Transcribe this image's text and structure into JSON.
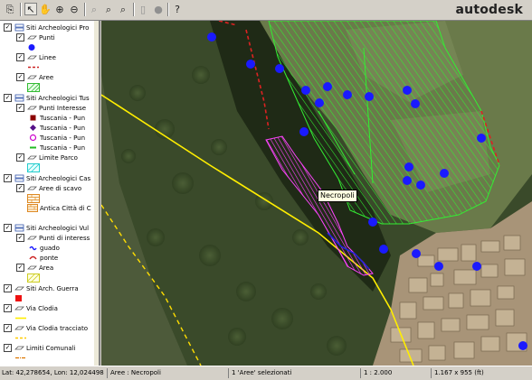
{
  "brand": "autodesk",
  "toolbar": {
    "buttons": [
      {
        "name": "copy-icon",
        "glyph": "⎘"
      },
      {
        "name": "select-arrow-icon",
        "glyph": "↖"
      },
      {
        "name": "pan-hand-icon",
        "glyph": "✋"
      },
      {
        "name": "zoom-in-icon",
        "glyph": "⊕"
      },
      {
        "name": "zoom-out-icon",
        "glyph": "⊖"
      },
      {
        "name": "zoom-previous-icon",
        "glyph": "⌕"
      },
      {
        "name": "zoom-window-icon",
        "glyph": "⌕"
      },
      {
        "name": "zoom-extents-icon",
        "glyph": "⌕"
      },
      {
        "name": "print-icon",
        "glyph": "▯"
      },
      {
        "name": "stop-icon",
        "glyph": "●"
      },
      {
        "name": "help-icon",
        "glyph": "?"
      }
    ]
  },
  "legend": {
    "groups": [
      {
        "label": "Siti Archeologici Pro",
        "checked": true
      },
      {
        "label": "Punti",
        "checked": true
      },
      {
        "label": "Linee",
        "checked": true
      },
      {
        "label": "Aree",
        "checked": true
      },
      {
        "label": "Siti Archeologici Tus",
        "checked": true
      },
      {
        "label": "Punti Interesse",
        "checked": true
      },
      {
        "label": "Tuscania - Pun",
        "checked": false
      },
      {
        "label": "Tuscania - Pun",
        "checked": false
      },
      {
        "label": "Tuscania - Pun",
        "checked": false
      },
      {
        "label": "Tuscania - Pun",
        "checked": false
      },
      {
        "label": "Limite Parco",
        "checked": true
      },
      {
        "label": "Siti Archeologici Cas",
        "checked": true
      },
      {
        "label": "Aree di scavo",
        "checked": true
      },
      {
        "label": "Antica Città di C",
        "checked": false
      },
      {
        "label": "Siti Archeologici Vul",
        "checked": true
      },
      {
        "label": "Punti di interess",
        "checked": true
      },
      {
        "label": "guado",
        "checked": false
      },
      {
        "label": "ponte",
        "checked": false
      },
      {
        "label": "Area",
        "checked": true
      },
      {
        "label": "Siti Arch. Guerra",
        "checked": true
      },
      {
        "label": "Via Clodia",
        "checked": true
      },
      {
        "label": "Via Clodia tracciato",
        "checked": true
      },
      {
        "label": "Limiti Comunali",
        "checked": true
      }
    ]
  },
  "map": {
    "tooltip": "Necropoli"
  },
  "status": {
    "coords": "Lat: 42,278654, Lon: 12,024498",
    "layer": "Aree : Necropoli",
    "selection": "1 'Aree' selezionati",
    "scale": "1 : 2.000",
    "size": "1.167 x 955 (ft)"
  },
  "colors": {
    "points_blue": "#1a1aff",
    "lines_red": "#cc2222",
    "area_green": "#33dd33",
    "highlight_magenta": "#ff44ff",
    "via_clodia_yellow": "#ffee00"
  }
}
